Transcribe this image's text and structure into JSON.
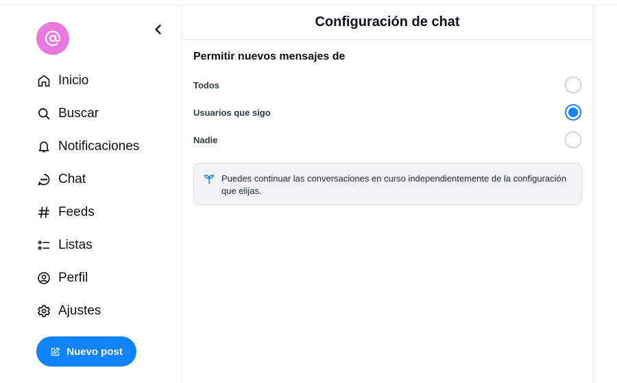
{
  "sidebar": {
    "avatar_icon": "at-sign-icon",
    "collapse_icon": "chevron-left-icon",
    "items": [
      {
        "label": "Inicio",
        "icon": "home-icon"
      },
      {
        "label": "Buscar",
        "icon": "search-icon"
      },
      {
        "label": "Notificaciones",
        "icon": "bell-icon"
      },
      {
        "label": "Chat",
        "icon": "chat-bubble-icon"
      },
      {
        "label": "Feeds",
        "icon": "hash-icon"
      },
      {
        "label": "Listas",
        "icon": "list-icon"
      },
      {
        "label": "Perfil",
        "icon": "user-circle-icon"
      },
      {
        "label": "Ajustes",
        "icon": "gear-icon"
      }
    ],
    "new_post_label": "Nuevo post",
    "new_post_icon": "edit-icon"
  },
  "main": {
    "title": "Configuración de chat",
    "section_title": "Permitir nuevos mensajes de",
    "options": [
      {
        "label": "Todos",
        "checked": false
      },
      {
        "label": "Usuarios que sigo",
        "checked": true
      },
      {
        "label": "Nadie",
        "checked": false
      }
    ],
    "notice_icon": "sprout-icon",
    "notice_text": "Puedes continuar las conversaciones en curso independientemente de la configuración que elijas."
  },
  "colors": {
    "accent": "#1083fe",
    "avatar": "#e879de",
    "border": "#e7eaee",
    "notice_bg": "#f1f3f5"
  }
}
